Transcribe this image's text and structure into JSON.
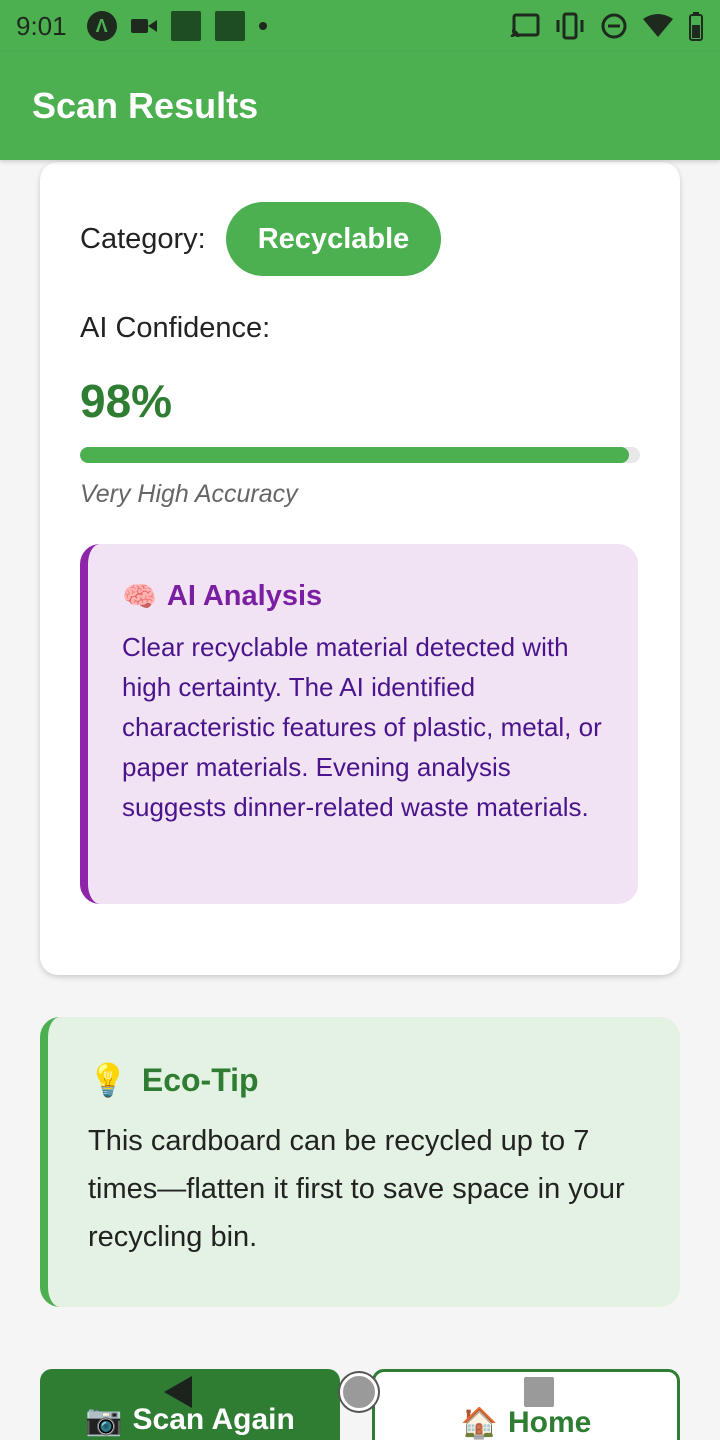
{
  "status_bar": {
    "time": "9:01",
    "left_icons": [
      "app-a-icon",
      "video-camera-icon",
      "notification-square-icon",
      "notification-square-icon",
      "dot-icon"
    ],
    "right_icons": [
      "cast-icon",
      "vibrate-icon",
      "do-not-disturb-icon",
      "wifi-icon",
      "battery-icon"
    ]
  },
  "app_bar": {
    "title": "Scan Results"
  },
  "result": {
    "category_label": "Category:",
    "category_value": "Recyclable",
    "confidence_label": "AI Confidence:",
    "confidence_value": "98%",
    "confidence_fraction": 0.98,
    "accuracy_text": "Very High Accuracy",
    "analysis": {
      "icon": "🧠",
      "title": "AI Analysis",
      "text": "Clear recyclable material detected with high certainty. The AI identified characteristic features of plastic, metal, or paper materials. Evening analysis suggests dinner-related waste materials."
    }
  },
  "eco_tip": {
    "icon": "💡",
    "title": "Eco-Tip",
    "text": "This cardboard can be recycled up to 7 times—flatten it first to save space in your recycling bin."
  },
  "buttons": {
    "scan_again": {
      "icon": "📷",
      "label": "Scan Again"
    },
    "home": {
      "icon": "🏠",
      "label": "Home"
    }
  },
  "colors": {
    "primary": "#4caf50",
    "primary_dark": "#2e7d32",
    "analysis_bg": "#f1e3f3",
    "analysis_accent": "#8e24aa",
    "tip_bg": "#e3f2e2"
  }
}
